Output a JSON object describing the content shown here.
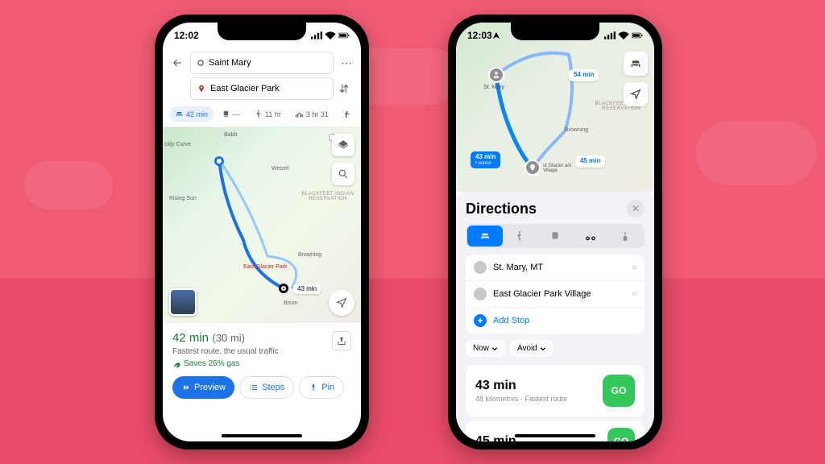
{
  "background": {
    "primary": "#f05b72",
    "secondary": "#e84b67"
  },
  "phoneA": {
    "status": {
      "time": "12:02",
      "signal": 4,
      "wifi": 3,
      "battery": 85
    },
    "search": {
      "origin": "Saint Mary",
      "destination": "East Glacier Park"
    },
    "modes": {
      "drive": "42 min",
      "transit": "—",
      "walk": "11 hr",
      "bike": "3 hr 31"
    },
    "map": {
      "labels": [
        "Babb",
        "Wetzel",
        "Rising Sun",
        "Browning",
        "Bison",
        "sidy Curve"
      ],
      "highway": "464",
      "reservation": "BLACKFEET INDIAN RESERVATION",
      "routeTime": "43 min",
      "destLabel": "East Glacier Park"
    },
    "card": {
      "time": "42 min",
      "distance": "(30 mi)",
      "subtitle": "Fastest route, the usual traffic",
      "eco": "Saves 26% gas",
      "buttons": {
        "preview": "Preview",
        "steps": "Steps",
        "pin": "Pin"
      }
    }
  },
  "phoneB": {
    "status": {
      "time": "12:03",
      "signal": 4,
      "wifi": 3,
      "battery": 84
    },
    "map": {
      "pins": [
        "St. Mary"
      ],
      "badges": {
        "fastest": "43 min",
        "fastestSub": "Fastest",
        "alt1": "54 min",
        "alt2": "45 min"
      },
      "reservation": "BLACKFEET INDIAN RESERVATION",
      "destLabel": "st Glacier ark Village",
      "townLabel": "Browning"
    },
    "sheet": {
      "title": "Directions",
      "stops": {
        "origin": "St. Mary, MT",
        "destination": "East Glacier Park Village",
        "add": "Add Stop"
      },
      "options": {
        "now": "Now",
        "avoid": "Avoid"
      },
      "routes": [
        {
          "time": "43 min",
          "sub": "48 kilometres · Fastest route",
          "go": "GO"
        },
        {
          "time": "45 min",
          "go": "GO"
        }
      ]
    }
  }
}
